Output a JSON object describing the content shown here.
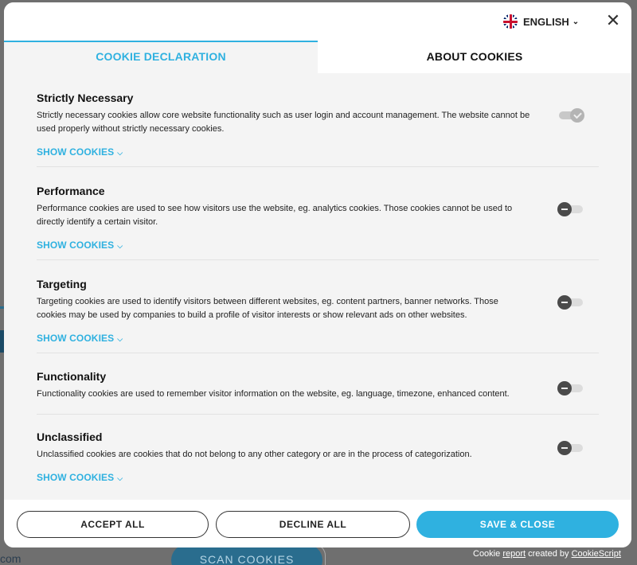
{
  "background": {
    "url_fragment": "com",
    "scan_button": "SCAN COOKIES"
  },
  "header": {
    "language": "ENGLISH",
    "close_glyph": "✕"
  },
  "tabs": [
    {
      "label": "COOKIE DECLARATION",
      "active": true
    },
    {
      "label": "ABOUT COOKIES",
      "active": false
    }
  ],
  "sections": [
    {
      "title": "Strictly Necessary",
      "description": "Strictly necessary cookies allow core website functionality such as user login and account management. The website cannot be used properly without strictly necessary cookies.",
      "show_label": "SHOW COOKIES",
      "toggle": "on-locked"
    },
    {
      "title": "Performance",
      "description": "Performance cookies are used to see how visitors use the website, eg. analytics cookies. Those cookies cannot be used to directly identify a certain visitor.",
      "show_label": "SHOW COOKIES",
      "toggle": "off"
    },
    {
      "title": "Targeting",
      "description": "Targeting cookies are used to identify visitors between different websites, eg. content partners, banner networks. Those cookies may be used by companies to build a profile of visitor interests or show relevant ads on other websites.",
      "show_label": "SHOW COOKIES",
      "toggle": "off"
    },
    {
      "title": "Functionality",
      "description": "Functionality cookies are used to remember visitor information on the website, eg. language, timezone, enhanced content.",
      "show_label": "",
      "toggle": "off"
    },
    {
      "title": "Unclassified",
      "description": "Unclassified cookies are cookies that do not belong to any other category or are in the process of categorization.",
      "show_label": "SHOW COOKIES",
      "toggle": "off"
    }
  ],
  "footer": {
    "accept_all": "ACCEPT ALL",
    "decline_all": "DECLINE ALL",
    "save_close": "SAVE & CLOSE"
  },
  "credit": {
    "prefix": "Cookie",
    "report_link": "report",
    "middle": "created by",
    "brand_link": "CookieScript"
  },
  "colors": {
    "accent": "#2fb1e0",
    "modal_bg": "#f4f4f4"
  }
}
